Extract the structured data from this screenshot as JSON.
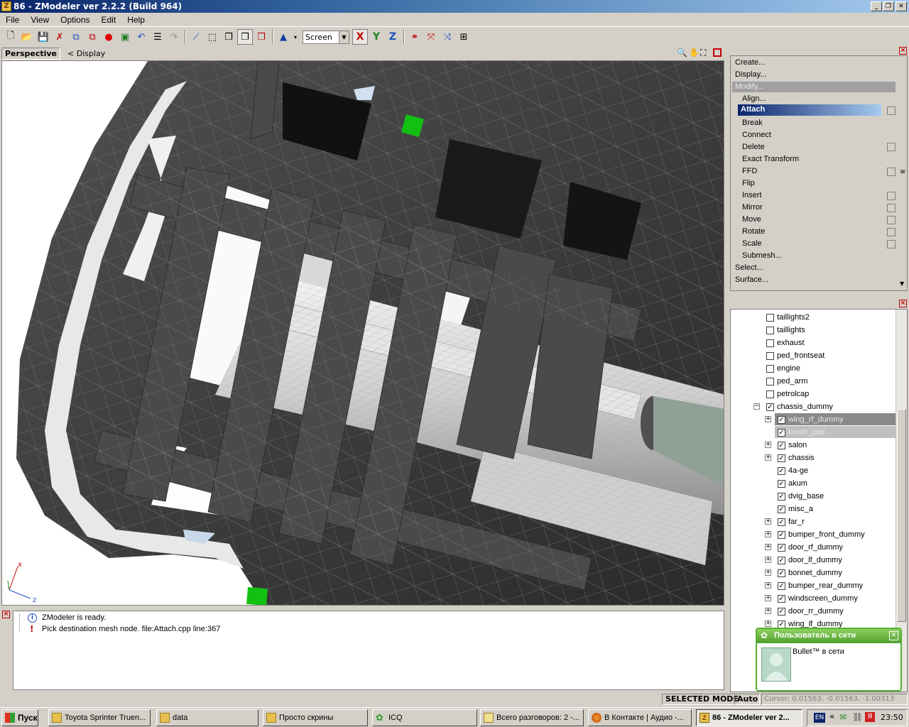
{
  "window": {
    "title": "86 - ZModeler ver 2.2.2 (Build 964)",
    "controls": [
      "_",
      "❐",
      "✕"
    ]
  },
  "menu": [
    "File",
    "View",
    "Options",
    "Edit",
    "Help"
  ],
  "toolbar": {
    "space_select": "Screen",
    "axis_x": "X",
    "axis_y": "Y",
    "axis_z": "Z"
  },
  "viewport": {
    "tab": "Perspective",
    "display_link": "< Display",
    "gizmo_x": "x",
    "gizmo_z": "z"
  },
  "command_panel": {
    "top": [
      "Create...",
      "Display...",
      "Modify..."
    ],
    "modify_items": [
      "Align...",
      "Attach",
      "Break",
      "Connect",
      "Delete",
      "Exact Transform",
      "FFD",
      "Flip",
      "Insert",
      "Mirror",
      "Move",
      "Rotate",
      "Scale",
      "Submesh..."
    ],
    "bottom": [
      "Select...",
      "Surface..."
    ]
  },
  "tree": [
    {
      "label": "taillights2",
      "checked": false,
      "level": 1
    },
    {
      "label": "taillights",
      "checked": false,
      "level": 1
    },
    {
      "label": "exhaust",
      "checked": false,
      "level": 1
    },
    {
      "label": "ped_frontseat",
      "checked": false,
      "level": 1
    },
    {
      "label": "engine",
      "checked": false,
      "level": 1
    },
    {
      "label": "ped_arm",
      "checked": false,
      "level": 1
    },
    {
      "label": "petrolcap",
      "checked": false,
      "level": 1
    },
    {
      "label": "chassis_dummy",
      "checked": true,
      "level": 1,
      "expanded": true
    },
    {
      "label": "wing_rf_dummy",
      "checked": true,
      "level": 2,
      "collapsed": true,
      "selected": true
    },
    {
      "label": "krush_pod",
      "checked": true,
      "level": 2,
      "selected": true
    },
    {
      "label": "salon",
      "checked": true,
      "level": 2,
      "collapsed": true
    },
    {
      "label": "chassis",
      "checked": true,
      "level": 2,
      "collapsed": true
    },
    {
      "label": "4a-ge",
      "checked": true,
      "level": 2
    },
    {
      "label": "akum",
      "checked": true,
      "level": 2
    },
    {
      "label": "dvig_base",
      "checked": true,
      "level": 2
    },
    {
      "label": "misc_a",
      "checked": true,
      "level": 2
    },
    {
      "label": "far_r",
      "checked": true,
      "level": 2,
      "collapsed": true
    },
    {
      "label": "bumper_front_dummy",
      "checked": true,
      "level": 2,
      "collapsed": true
    },
    {
      "label": "door_rf_dummy",
      "checked": true,
      "level": 2,
      "collapsed": true
    },
    {
      "label": "door_lf_dummy",
      "checked": true,
      "level": 2,
      "collapsed": true
    },
    {
      "label": "bonnet_dummy",
      "checked": true,
      "level": 2,
      "collapsed": true
    },
    {
      "label": "bumper_rear_dummy",
      "checked": true,
      "level": 2,
      "collapsed": true
    },
    {
      "label": "windscreen_dummy",
      "checked": true,
      "level": 2,
      "collapsed": true
    },
    {
      "label": "door_rr_dummy",
      "checked": true,
      "level": 2,
      "collapsed": true
    },
    {
      "label": "wing_lf_dummy",
      "checked": true,
      "level": 2,
      "collapsed": true
    }
  ],
  "log": [
    "ZModeler is ready.",
    "Pick destination mesh node. file:Attach.cpp line:367"
  ],
  "status": {
    "mode": "SELECTED MODE",
    "auto": "Auto",
    "cursor": "Cursor: 0.01563, -0.01563, -1.00313"
  },
  "icq_popup": {
    "title": "Пользователь в сети",
    "message": "Bullet™ в сети"
  },
  "taskbar": {
    "start": "Пуск",
    "tasks": [
      "Toyota Sprinter Truen...",
      "data",
      "Просто скрины",
      "ICQ",
      "Всего разговоров: 2 -...",
      "В Контакте | Аудио -...",
      "86 - ZModeler ver 2..."
    ],
    "lang": "EN",
    "chevron": "«",
    "clock": "23:50"
  }
}
